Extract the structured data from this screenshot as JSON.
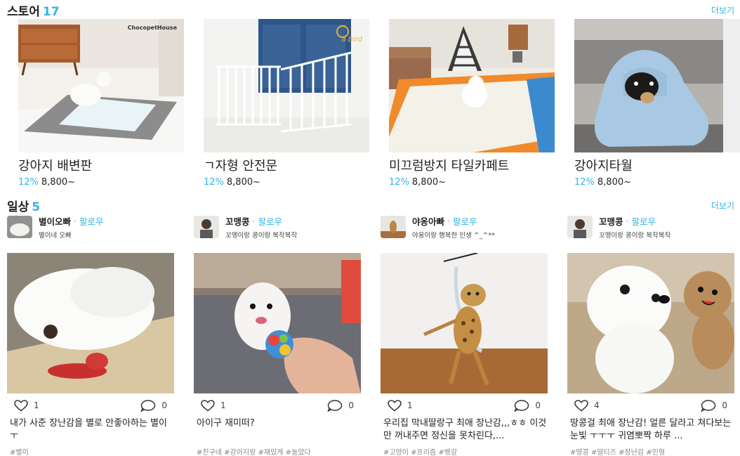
{
  "store": {
    "title": "스토어",
    "count": "17",
    "more": "더보기",
    "items": [
      {
        "name": "강아지 배변판",
        "discount": "12%",
        "price": "8,800~",
        "brand": "ChocopetHouse"
      },
      {
        "name": "ㄱ자형 안전문",
        "discount": "12%",
        "price": "8,800~",
        "brand": "a Bird"
      },
      {
        "name": "미끄럼방지 타일카페트",
        "discount": "12%",
        "price": "8,800~"
      },
      {
        "name": "강아지타월",
        "discount": "12%",
        "price": "8,800~"
      }
    ]
  },
  "daily": {
    "title": "일상",
    "count": "5",
    "more": "더보기",
    "follow_sep": "·",
    "follow": "팔로우",
    "posts": [
      {
        "author": "별이오빠",
        "bio": "별이네 오빠",
        "likes": "1",
        "comments": "0",
        "text": "내가 사준 장난감을 별로 안좋아하는 별이 ㅜ",
        "tags": "#별이"
      },
      {
        "author": "꼬맹콩",
        "bio": "꼬맹이랑 콩이랑 복작복작",
        "likes": "1",
        "comments": "0",
        "text": "아이구 재미떠?",
        "tags": "#친구네 #강아지랑 #재밌게 #놀았다"
      },
      {
        "author": "야옹아빠",
        "bio": "야옹이랑 행복한 인생 ^_^**",
        "likes": "1",
        "comments": "0",
        "text": "우리집 막내딸랑구 최애 장난감,,,ㅎㅎ 이것만 꺼내주면 정신을 못차린다,...",
        "tags": "#고양이 #프리즘 #벵갈"
      },
      {
        "author": "꼬맹콩",
        "bio": "꼬맹이랑 콩이랑 복작복작",
        "likes": "4",
        "comments": "0",
        "text": "땅콩걸 최애 장난감! 얼른 달라고 쳐다보는 눈빛 ㅜㅜㅜ 귀염뽀짝 하루 ...",
        "tags": "#땅콩 #말티즈 #장난감 #인형"
      }
    ]
  }
}
